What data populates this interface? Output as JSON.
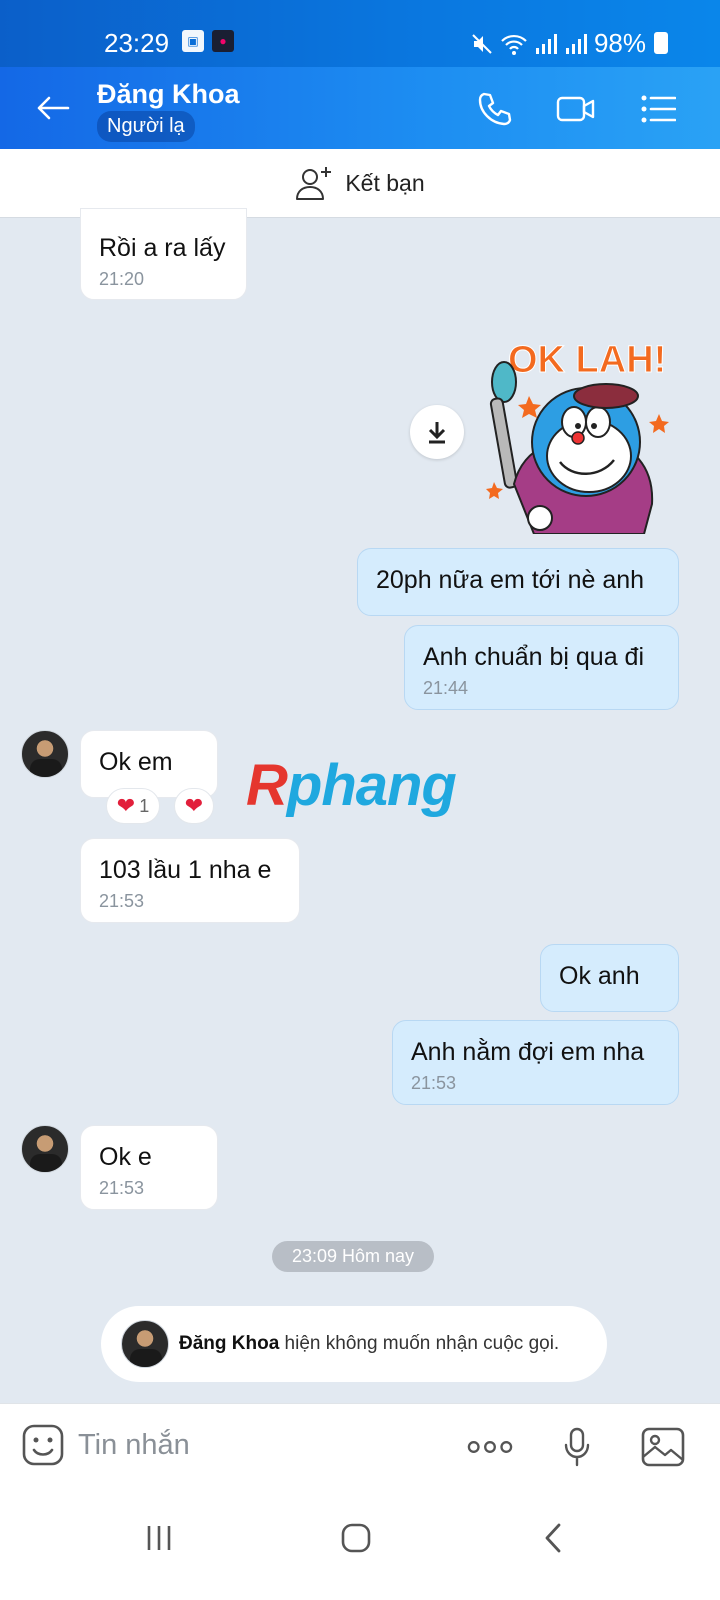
{
  "status_bar": {
    "time": "23:29",
    "battery": "98%"
  },
  "header": {
    "contact_name": "Đăng Khoa",
    "badge": "Người lạ"
  },
  "friend_bar": {
    "label": "Kết bạn"
  },
  "messages": [
    {
      "side": "in",
      "text": "Rồi a ra lấy",
      "time": "21:20"
    },
    {
      "side": "out",
      "text": "20ph nữa em tới nè anh",
      "time": ""
    },
    {
      "side": "out",
      "text": "Anh chuẩn bị qua đi",
      "time": "21:44"
    },
    {
      "side": "in",
      "text": "Ok em",
      "time": ""
    },
    {
      "side": "in",
      "text": "103 lầu 1 nha e",
      "time": "21:53"
    },
    {
      "side": "out",
      "text": "Ok anh",
      "time": ""
    },
    {
      "side": "out",
      "text": "Anh nằm đợi em nha",
      "time": "21:53"
    },
    {
      "side": "in",
      "text": "Ok e",
      "time": "21:53"
    }
  ],
  "sticker": {
    "text": "OK LAH!"
  },
  "reactions": {
    "count": "1"
  },
  "watermark": {
    "first": "R",
    "rest": "phang"
  },
  "date_separator": "23:09 Hôm nay",
  "notice": {
    "name": "Đăng Khoa",
    "text": " hiện không muốn nhận cuộc gọi."
  },
  "input": {
    "placeholder": "Tin nhắn"
  },
  "colors": {
    "header": "#1d8ef2",
    "out_bubble": "#d5ecfd",
    "background": "#e2e9f1"
  }
}
